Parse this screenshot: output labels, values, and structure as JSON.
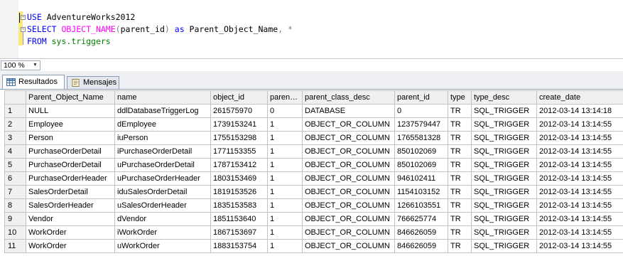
{
  "editor": {
    "lines": [
      {
        "keyword": "USE",
        "rest": " AdventureWorks2012"
      },
      {
        "keyword": "SELECT",
        "fn": "OBJECT_NAME",
        "paren_open": "(",
        "arg": "parent_id",
        "paren_close": ")",
        "as_kw": " as",
        "alias": " Parent_Object_Name",
        "comma": ",",
        "star": " *"
      },
      {
        "keyword": "FROM",
        "object": " sys.triggers"
      }
    ]
  },
  "zoom": {
    "value": "100 %"
  },
  "tabs": [
    {
      "label": "Resultados",
      "icon": "grid-results-icon"
    },
    {
      "label": "Mensajes",
      "icon": "messages-icon"
    }
  ],
  "grid": {
    "columns": [
      "",
      "Parent_Object_Name",
      "name",
      "object_id",
      "paren…",
      "parent_class_desc",
      "parent_id",
      "type",
      "type_desc",
      "create_date"
    ],
    "rows": [
      [
        "1",
        "NULL",
        "ddlDatabaseTriggerLog",
        "261575970",
        "0",
        "DATABASE",
        "0",
        "TR",
        "SQL_TRIGGER",
        "2012-03-14 13:14:18"
      ],
      [
        "2",
        "Employee",
        "dEmployee",
        "1739153241",
        "1",
        "OBJECT_OR_COLUMN",
        "1237579447",
        "TR",
        "SQL_TRIGGER",
        "2012-03-14 13:14:55"
      ],
      [
        "3",
        "Person",
        "iuPerson",
        "1755153298",
        "1",
        "OBJECT_OR_COLUMN",
        "1765581328",
        "TR",
        "SQL_TRIGGER",
        "2012-03-14 13:14:55"
      ],
      [
        "4",
        "PurchaseOrderDetail",
        "iPurchaseOrderDetail",
        "1771153355",
        "1",
        "OBJECT_OR_COLUMN",
        "850102069",
        "TR",
        "SQL_TRIGGER",
        "2012-03-14 13:14:55"
      ],
      [
        "5",
        "PurchaseOrderDetail",
        "uPurchaseOrderDetail",
        "1787153412",
        "1",
        "OBJECT_OR_COLUMN",
        "850102069",
        "TR",
        "SQL_TRIGGER",
        "2012-03-14 13:14:55"
      ],
      [
        "6",
        "PurchaseOrderHeader",
        "uPurchaseOrderHeader",
        "1803153469",
        "1",
        "OBJECT_OR_COLUMN",
        "946102411",
        "TR",
        "SQL_TRIGGER",
        "2012-03-14 13:14:55"
      ],
      [
        "7",
        "SalesOrderDetail",
        "iduSalesOrderDetail",
        "1819153526",
        "1",
        "OBJECT_OR_COLUMN",
        "1154103152",
        "TR",
        "SQL_TRIGGER",
        "2012-03-14 13:14:55"
      ],
      [
        "8",
        "SalesOrderHeader",
        "uSalesOrderHeader",
        "1835153583",
        "1",
        "OBJECT_OR_COLUMN",
        "1266103551",
        "TR",
        "SQL_TRIGGER",
        "2012-03-14 13:14:55"
      ],
      [
        "9",
        "Vendor",
        "dVendor",
        "1851153640",
        "1",
        "OBJECT_OR_COLUMN",
        "766625774",
        "TR",
        "SQL_TRIGGER",
        "2012-03-14 13:14:55"
      ],
      [
        "10",
        "WorkOrder",
        "iWorkOrder",
        "1867153697",
        "1",
        "OBJECT_OR_COLUMN",
        "846626059",
        "TR",
        "SQL_TRIGGER",
        "2012-03-14 13:14:55"
      ],
      [
        "11",
        "WorkOrder",
        "uWorkOrder",
        "1883153754",
        "1",
        "OBJECT_OR_COLUMN",
        "846626059",
        "TR",
        "SQL_TRIGGER",
        "2012-03-14 13:14:55"
      ]
    ]
  },
  "colors": {
    "keyword": "#0000ff",
    "function": "#ff00ff",
    "system_object": "#008000",
    "operator": "#808080",
    "header_bg": "#f0f0f0",
    "gridline": "#c3c3c3"
  }
}
